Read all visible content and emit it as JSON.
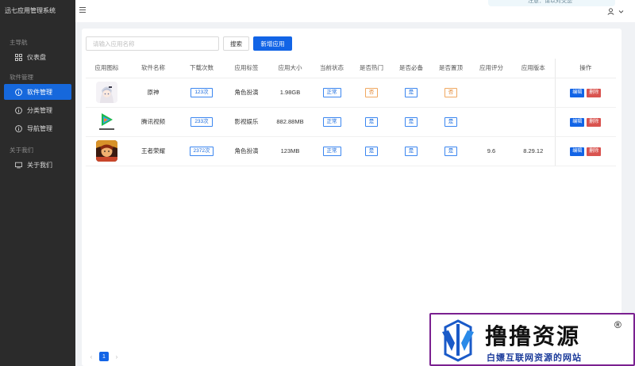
{
  "app_title": "迅七应用管理系统",
  "sidebar": {
    "groups": [
      {
        "title": "主导航",
        "items": [
          {
            "label": "仪表盘",
            "icon": "dashboard-icon"
          }
        ]
      },
      {
        "title": "软件管理",
        "items": [
          {
            "label": "软件管理",
            "icon": "info-icon",
            "active": true
          },
          {
            "label": "分类管理",
            "icon": "info-icon"
          },
          {
            "label": "导航管理",
            "icon": "info-icon"
          }
        ]
      },
      {
        "title": "关于我们",
        "items": [
          {
            "label": "关于我们",
            "icon": "monitor-icon"
          }
        ]
      }
    ]
  },
  "header": {
    "notice_text": "注意：请以对交您"
  },
  "toolbar": {
    "search_placeholder": "请输入应用名称",
    "search_value": "",
    "search_label": "搜索",
    "add_label": "新增应用"
  },
  "table": {
    "columns": [
      "应用图标",
      "软件名称",
      "下载次数",
      "应用标签",
      "应用大小",
      "当前状态",
      "是否热门",
      "是否必备",
      "是否置顶",
      "应用评分",
      "应用版本",
      "操作"
    ],
    "rows": [
      {
        "icon": "genshin-app-icon",
        "name": "原神",
        "downloads": "123次",
        "tag": "角色扮演",
        "size": "1.98GB",
        "status": "正常",
        "hot": "否",
        "essential": "是",
        "top": "否",
        "rating": "",
        "version": ""
      },
      {
        "icon": "tencent-video-app-icon",
        "name": "腾讯视频",
        "downloads": "233次",
        "tag": "影视娱乐",
        "size": "882.88MB",
        "status": "正常",
        "hot": "是",
        "essential": "是",
        "top": "是",
        "rating": "",
        "version": ""
      },
      {
        "icon": "honor-of-kings-app-icon",
        "name": "王者荣耀",
        "downloads": "2372次",
        "tag": "角色扮演",
        "size": "123MB",
        "status": "正常",
        "hot": "是",
        "essential": "是",
        "top": "是",
        "rating": "9.6",
        "version": "8.29.12"
      }
    ],
    "edit_label": "编辑",
    "delete_label": "删除"
  },
  "pager": {
    "current": "1",
    "prev": "‹",
    "next": "›"
  },
  "watermark": {
    "title": "撸撸资源",
    "reg": "®",
    "subtitle": "白嫖互联网资源的网站"
  },
  "colors": {
    "primary": "#1264e6",
    "danger": "#d9534f",
    "warn": "#e07d20",
    "sidebar_bg": "#2b2b2b"
  }
}
